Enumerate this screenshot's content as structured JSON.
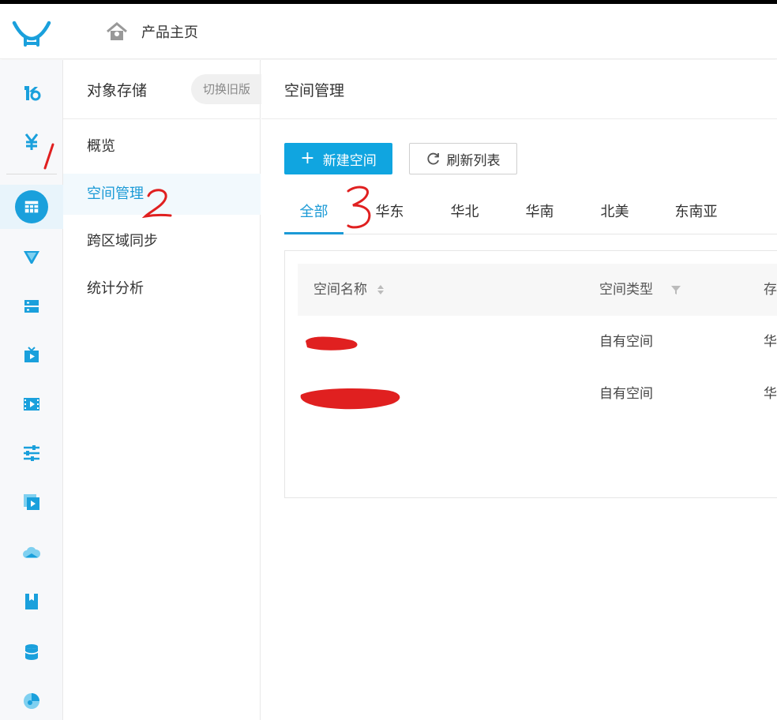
{
  "topbar": {
    "home_label": "产品主页"
  },
  "iconbar": {
    "items": [
      {
        "icon": "kodo-brand-icon"
      },
      {
        "icon": "yen-icon"
      },
      {
        "icon": "grid-storage-icon"
      },
      {
        "icon": "cdn-funnel-icon"
      },
      {
        "icon": "server-icon"
      },
      {
        "icon": "live-tv-icon"
      },
      {
        "icon": "video-film-icon"
      },
      {
        "icon": "sliders-icon"
      },
      {
        "icon": "media-play-icon"
      },
      {
        "icon": "cloud-icon"
      },
      {
        "icon": "bookmark-icon"
      },
      {
        "icon": "database-icon"
      },
      {
        "icon": "analytics-icon"
      }
    ]
  },
  "subnav": {
    "title": "对象存储",
    "switch_old": "切换旧版",
    "items": [
      {
        "label": "概览"
      },
      {
        "label": "空间管理"
      },
      {
        "label": "跨区域同步"
      },
      {
        "label": "统计分析"
      }
    ]
  },
  "main": {
    "title": "空间管理",
    "new_bucket": "新建空间",
    "refresh": "刷新列表",
    "tabs": [
      {
        "label": "全部"
      },
      {
        "label": "华东"
      },
      {
        "label": "华北"
      },
      {
        "label": "华南"
      },
      {
        "label": "北美"
      },
      {
        "label": "东南亚"
      }
    ],
    "table": {
      "headers": [
        "空间名称",
        "空间类型",
        "存"
      ],
      "rows": [
        {
          "type": "自有空间",
          "region": "华"
        },
        {
          "type": "自有空间",
          "region": "华"
        }
      ]
    }
  },
  "annotations": [
    "1",
    "2",
    "3"
  ],
  "colors": {
    "accent": "#10a5e0",
    "active_text": "#1b9ad6",
    "annotation_red": "#e02020"
  }
}
